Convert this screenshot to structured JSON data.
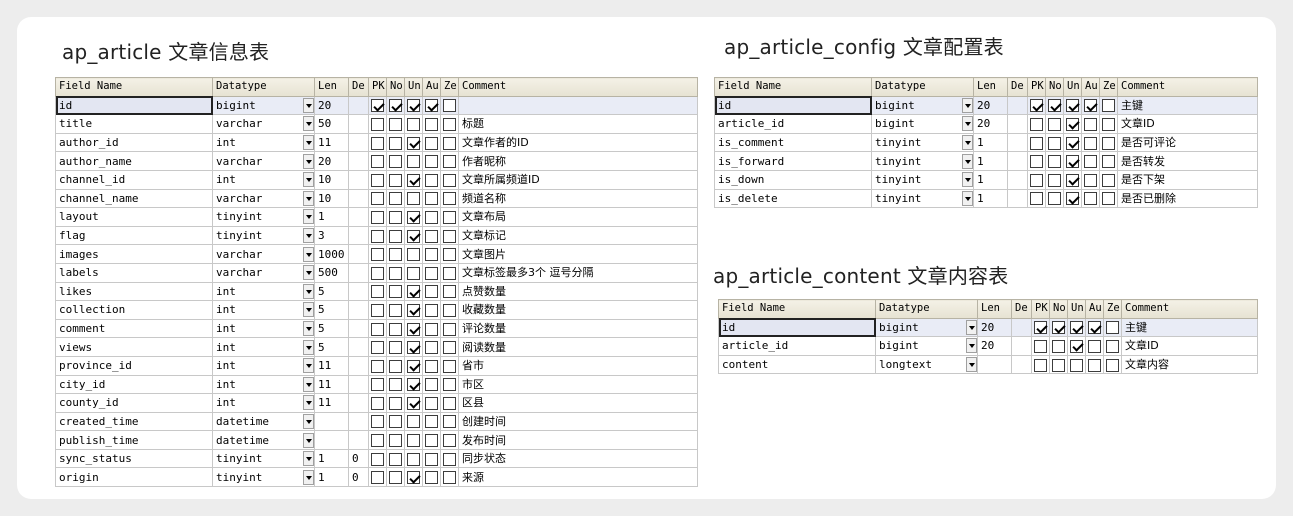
{
  "columns": [
    "Field Name",
    "Datatype",
    "Len",
    "De",
    "PK",
    "No",
    "Un",
    "Au",
    "Ze",
    "Comment"
  ],
  "tables": [
    {
      "title": "ap_article  文章信息表",
      "rows": [
        {
          "field": "id",
          "type": "bigint",
          "len": "20",
          "de": "",
          "pk": true,
          "no": true,
          "un": true,
          "au": true,
          "ze": false,
          "comment": ""
        },
        {
          "field": "title",
          "type": "varchar",
          "len": "50",
          "de": "",
          "pk": false,
          "no": false,
          "un": false,
          "au": false,
          "ze": false,
          "comment": "标题"
        },
        {
          "field": "author_id",
          "type": "int",
          "len": "11",
          "de": "",
          "pk": false,
          "no": false,
          "un": true,
          "au": false,
          "ze": false,
          "comment": "文章作者的ID"
        },
        {
          "field": "author_name",
          "type": "varchar",
          "len": "20",
          "de": "",
          "pk": false,
          "no": false,
          "un": false,
          "au": false,
          "ze": false,
          "comment": "作者昵称"
        },
        {
          "field": "channel_id",
          "type": "int",
          "len": "10",
          "de": "",
          "pk": false,
          "no": false,
          "un": true,
          "au": false,
          "ze": false,
          "comment": "文章所属频道ID"
        },
        {
          "field": "channel_name",
          "type": "varchar",
          "len": "10",
          "de": "",
          "pk": false,
          "no": false,
          "un": false,
          "au": false,
          "ze": false,
          "comment": "频道名称"
        },
        {
          "field": "layout",
          "type": "tinyint",
          "len": "1",
          "de": "",
          "pk": false,
          "no": false,
          "un": true,
          "au": false,
          "ze": false,
          "comment": "文章布局"
        },
        {
          "field": "flag",
          "type": "tinyint",
          "len": "3",
          "de": "",
          "pk": false,
          "no": false,
          "un": true,
          "au": false,
          "ze": false,
          "comment": "文章标记"
        },
        {
          "field": "images",
          "type": "varchar",
          "len": "1000",
          "de": "",
          "pk": false,
          "no": false,
          "un": false,
          "au": false,
          "ze": false,
          "comment": "文章图片"
        },
        {
          "field": "labels",
          "type": "varchar",
          "len": "500",
          "de": "",
          "pk": false,
          "no": false,
          "un": false,
          "au": false,
          "ze": false,
          "comment": "文章标签最多3个 逗号分隔"
        },
        {
          "field": "likes",
          "type": "int",
          "len": "5",
          "de": "",
          "pk": false,
          "no": false,
          "un": true,
          "au": false,
          "ze": false,
          "comment": "点赞数量"
        },
        {
          "field": "collection",
          "type": "int",
          "len": "5",
          "de": "",
          "pk": false,
          "no": false,
          "un": true,
          "au": false,
          "ze": false,
          "comment": "收藏数量"
        },
        {
          "field": "comment",
          "type": "int",
          "len": "5",
          "de": "",
          "pk": false,
          "no": false,
          "un": true,
          "au": false,
          "ze": false,
          "comment": "评论数量"
        },
        {
          "field": "views",
          "type": "int",
          "len": "5",
          "de": "",
          "pk": false,
          "no": false,
          "un": true,
          "au": false,
          "ze": false,
          "comment": "阅读数量"
        },
        {
          "field": "province_id",
          "type": "int",
          "len": "11",
          "de": "",
          "pk": false,
          "no": false,
          "un": true,
          "au": false,
          "ze": false,
          "comment": "省市"
        },
        {
          "field": "city_id",
          "type": "int",
          "len": "11",
          "de": "",
          "pk": false,
          "no": false,
          "un": true,
          "au": false,
          "ze": false,
          "comment": "市区"
        },
        {
          "field": "county_id",
          "type": "int",
          "len": "11",
          "de": "",
          "pk": false,
          "no": false,
          "un": true,
          "au": false,
          "ze": false,
          "comment": "区县"
        },
        {
          "field": "created_time",
          "type": "datetime",
          "len": "",
          "de": "",
          "pk": false,
          "no": false,
          "un": false,
          "au": false,
          "ze": false,
          "comment": "创建时间"
        },
        {
          "field": "publish_time",
          "type": "datetime",
          "len": "",
          "de": "",
          "pk": false,
          "no": false,
          "un": false,
          "au": false,
          "ze": false,
          "comment": "发布时间"
        },
        {
          "field": "sync_status",
          "type": "tinyint",
          "len": "1",
          "de": "0",
          "pk": false,
          "no": false,
          "un": false,
          "au": false,
          "ze": false,
          "comment": "同步状态"
        },
        {
          "field": "origin",
          "type": "tinyint",
          "len": "1",
          "de": "0",
          "pk": false,
          "no": false,
          "un": true,
          "au": false,
          "ze": false,
          "comment": "来源"
        }
      ]
    },
    {
      "title": "ap_article_config   文章配置表",
      "rows": [
        {
          "field": "id",
          "type": "bigint",
          "len": "20",
          "de": "",
          "pk": true,
          "no": true,
          "un": true,
          "au": true,
          "ze": false,
          "comment": "主键"
        },
        {
          "field": "article_id",
          "type": "bigint",
          "len": "20",
          "de": "",
          "pk": false,
          "no": false,
          "un": true,
          "au": false,
          "ze": false,
          "comment": "文章ID"
        },
        {
          "field": "is_comment",
          "type": "tinyint",
          "len": "1",
          "de": "",
          "pk": false,
          "no": false,
          "un": true,
          "au": false,
          "ze": false,
          "comment": "是否可评论"
        },
        {
          "field": "is_forward",
          "type": "tinyint",
          "len": "1",
          "de": "",
          "pk": false,
          "no": false,
          "un": true,
          "au": false,
          "ze": false,
          "comment": "是否转发"
        },
        {
          "field": "is_down",
          "type": "tinyint",
          "len": "1",
          "de": "",
          "pk": false,
          "no": false,
          "un": true,
          "au": false,
          "ze": false,
          "comment": "是否下架"
        },
        {
          "field": "is_delete",
          "type": "tinyint",
          "len": "1",
          "de": "",
          "pk": false,
          "no": false,
          "un": true,
          "au": false,
          "ze": false,
          "comment": "是否已删除"
        }
      ]
    },
    {
      "title": "ap_article_content  文章内容表",
      "rows": [
        {
          "field": "id",
          "type": "bigint",
          "len": "20",
          "de": "",
          "pk": true,
          "no": true,
          "un": true,
          "au": true,
          "ze": false,
          "comment": "主键"
        },
        {
          "field": "article_id",
          "type": "bigint",
          "len": "20",
          "de": "",
          "pk": false,
          "no": false,
          "un": true,
          "au": false,
          "ze": false,
          "comment": "文章ID"
        },
        {
          "field": "content",
          "type": "longtext",
          "len": "",
          "de": "",
          "pk": false,
          "no": false,
          "un": false,
          "au": false,
          "ze": false,
          "comment": "文章内容"
        }
      ]
    }
  ],
  "colors": {
    "header_bg": "#ece9d8",
    "selected_row_bg": "#e9ecf6",
    "grid_line": "#c8c8c8",
    "card_bg": "#ffffff",
    "page_bg": "#ededed"
  }
}
